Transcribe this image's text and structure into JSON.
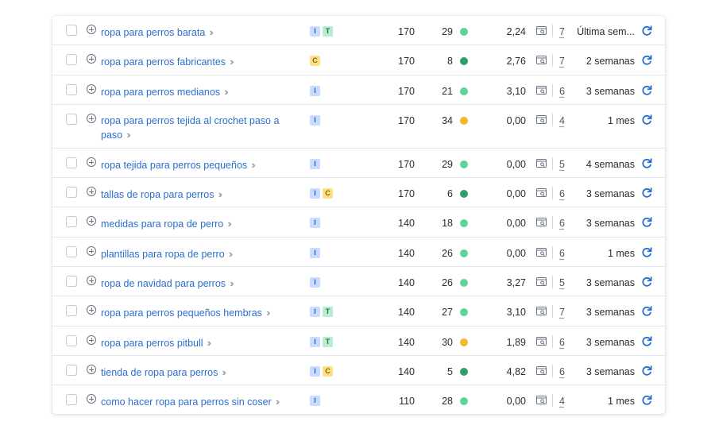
{
  "colors": {
    "link": "#2b6fce",
    "kd_easy": "#5fd49a",
    "kd_medium": "#f2b733",
    "kd_dark": "#2f9e6c",
    "refresh": "#2b6fce"
  },
  "rows": [
    {
      "keyword": "ropa para perros barata",
      "intents": [
        "I",
        "T"
      ],
      "volume": "170",
      "kd": "29",
      "kd_color": "#5fd49a",
      "cpc": "2,24",
      "results": "7",
      "updated": "Última sem..."
    },
    {
      "keyword": "ropa para perros fabricantes",
      "intents": [
        "C"
      ],
      "volume": "170",
      "kd": "8",
      "kd_color": "#2f9e6c",
      "cpc": "2,76",
      "results": "7",
      "updated": "2 semanas"
    },
    {
      "keyword": "ropa para perros medianos",
      "intents": [
        "I"
      ],
      "volume": "170",
      "kd": "21",
      "kd_color": "#5fd49a",
      "cpc": "3,10",
      "results": "6",
      "updated": "3 semanas"
    },
    {
      "keyword": "ropa para perros tejida al crochet paso a paso",
      "intents": [
        "I"
      ],
      "volume": "170",
      "kd": "34",
      "kd_color": "#f2b733",
      "cpc": "0,00",
      "results": "4",
      "updated": "1 mes"
    },
    {
      "keyword": "ropa tejida para perros pequeños",
      "intents": [
        "I"
      ],
      "volume": "170",
      "kd": "29",
      "kd_color": "#5fd49a",
      "cpc": "0,00",
      "results": "5",
      "updated": "4 semanas"
    },
    {
      "keyword": "tallas de ropa para perros",
      "intents": [
        "I",
        "C"
      ],
      "volume": "170",
      "kd": "6",
      "kd_color": "#2f9e6c",
      "cpc": "0,00",
      "results": "6",
      "updated": "3 semanas"
    },
    {
      "keyword": "medidas para ropa de perro",
      "intents": [
        "I"
      ],
      "volume": "140",
      "kd": "18",
      "kd_color": "#5fd49a",
      "cpc": "0,00",
      "results": "6",
      "updated": "3 semanas"
    },
    {
      "keyword": "plantillas para ropa de perro",
      "intents": [
        "I"
      ],
      "volume": "140",
      "kd": "26",
      "kd_color": "#5fd49a",
      "cpc": "0,00",
      "results": "6",
      "updated": "1 mes"
    },
    {
      "keyword": "ropa de navidad para perros",
      "intents": [
        "I"
      ],
      "volume": "140",
      "kd": "26",
      "kd_color": "#5fd49a",
      "cpc": "3,27",
      "results": "5",
      "updated": "3 semanas"
    },
    {
      "keyword": "ropa para perros pequeños hembras",
      "intents": [
        "I",
        "T"
      ],
      "volume": "140",
      "kd": "27",
      "kd_color": "#5fd49a",
      "cpc": "3,10",
      "results": "7",
      "updated": "3 semanas"
    },
    {
      "keyword": "ropa para perros pitbull",
      "intents": [
        "I",
        "T"
      ],
      "volume": "140",
      "kd": "30",
      "kd_color": "#f2b733",
      "cpc": "1,89",
      "results": "6",
      "updated": "3 semanas"
    },
    {
      "keyword": "tienda de ropa para perros",
      "intents": [
        "I",
        "C"
      ],
      "volume": "140",
      "kd": "5",
      "kd_color": "#2f9e6c",
      "cpc": "4,82",
      "results": "6",
      "updated": "3 semanas"
    },
    {
      "keyword": "como hacer ropa para perros sin coser",
      "intents": [
        "I"
      ],
      "volume": "110",
      "kd": "28",
      "kd_color": "#5fd49a",
      "cpc": "0,00",
      "results": "4",
      "updated": "1 mes"
    }
  ]
}
